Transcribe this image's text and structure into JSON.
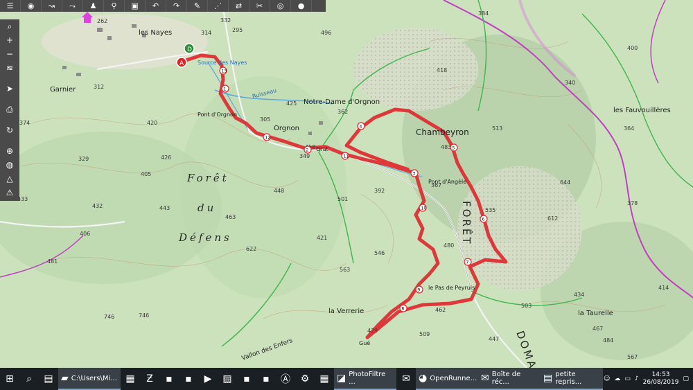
{
  "map": {
    "place_labels": {
      "nayes": "les Nayes",
      "garnier": "Garnier",
      "orgnon": "Orgnon",
      "notre_dame": "Notre-Dame\nd'Orgnon",
      "chambeyron": "Chambeyron",
      "pont_orgnon": "Pont d'Orgnon",
      "pont_angele": "Pont d'Angèle",
      "fauvouilleres": "les Fauvouillères",
      "verrerie": "la Verrerie",
      "taurelle": "la Taurelle",
      "pas_peyruis": "le Pas\nde Peyruis",
      "vallon": "Vallon des Enfers",
      "source": "Source\ndes Nayes",
      "ruisseau": "Ruisseau",
      "orat": "Orat",
      "gue": "Gué",
      "cit": "Cit"
    },
    "forest_words": [
      "Forêt",
      "du",
      "Défens"
    ],
    "foret_vertical": "FORÊT",
    "doma": "DOMA",
    "elevations": [
      "262",
      "314",
      "332",
      "295",
      "496",
      "384",
      "400",
      "418",
      "340",
      "364",
      "378",
      "513",
      "483",
      "644",
      "612",
      "535",
      "480",
      "503",
      "434",
      "414",
      "467",
      "458",
      "425",
      "362",
      "305",
      "349",
      "392",
      "367",
      "501",
      "546",
      "563",
      "462",
      "447",
      "429",
      "509",
      "374",
      "329",
      "432",
      "433",
      "406",
      "481",
      "443",
      "463",
      "622",
      "421",
      "448",
      "405",
      "746",
      "746",
      "312",
      "420",
      "426",
      "567",
      "484"
    ],
    "waypoints": [
      "13",
      "1",
      "12",
      "2",
      "11",
      "4",
      "3",
      "5",
      "10",
      "6",
      "9",
      "7",
      "8"
    ],
    "start_marker": "A",
    "end_marker": "D",
    "route_color": "#e0262c"
  },
  "toolbar_top": {
    "icons": [
      "menu-icon",
      "camera-icon",
      "route-icon",
      "route-add-icon",
      "hiker-icon",
      "bike-icon",
      "car-icon",
      "undo-icon",
      "redo-icon",
      "pencil-icon",
      "waypoint-icon",
      "reverse-icon",
      "cut-icon",
      "eye-icon",
      "marker-icon"
    ]
  },
  "toolbar_left": {
    "icons": [
      "search-icon",
      "zoom-in-icon",
      "zoom-out-icon",
      "layers-icon",
      "locate-icon",
      "print-icon",
      "refresh-icon",
      "target-icon",
      "globe-icon",
      "triangle-icon",
      "warning-icon"
    ]
  },
  "taskbar": {
    "items": [
      {
        "label": "",
        "icon": "start-icon"
      },
      {
        "label": "",
        "icon": "search-icon"
      },
      {
        "label": "",
        "icon": "taskview-icon"
      },
      {
        "label": "C:\\Users\\Mi...",
        "icon": "folder-icon"
      },
      {
        "label": "",
        "icon": "store-icon"
      },
      {
        "label": "",
        "icon": "filezilla-icon"
      },
      {
        "label": "",
        "icon": "app-icon"
      },
      {
        "label": "",
        "icon": "app-icon"
      },
      {
        "label": "",
        "icon": "media-icon"
      },
      {
        "label": "",
        "icon": "photo-icon"
      },
      {
        "label": "",
        "icon": "app-icon"
      },
      {
        "label": "",
        "icon": "app-icon"
      },
      {
        "label": "",
        "icon": "acrobat-icon"
      },
      {
        "label": "",
        "icon": "settings-icon"
      },
      {
        "label": "",
        "icon": "calculator-icon"
      },
      {
        "label": "PhotoFiltre ...",
        "icon": "photofiltre-icon"
      },
      {
        "label": "",
        "icon": "mail-icon"
      },
      {
        "label": "OpenRunne...",
        "icon": "firefox-icon"
      },
      {
        "label": "Boîte de réc...",
        "icon": "mail-icon"
      },
      {
        "label": "petite repris...",
        "icon": "document-icon"
      }
    ],
    "time": "14:53",
    "date": "26/08/2019"
  }
}
